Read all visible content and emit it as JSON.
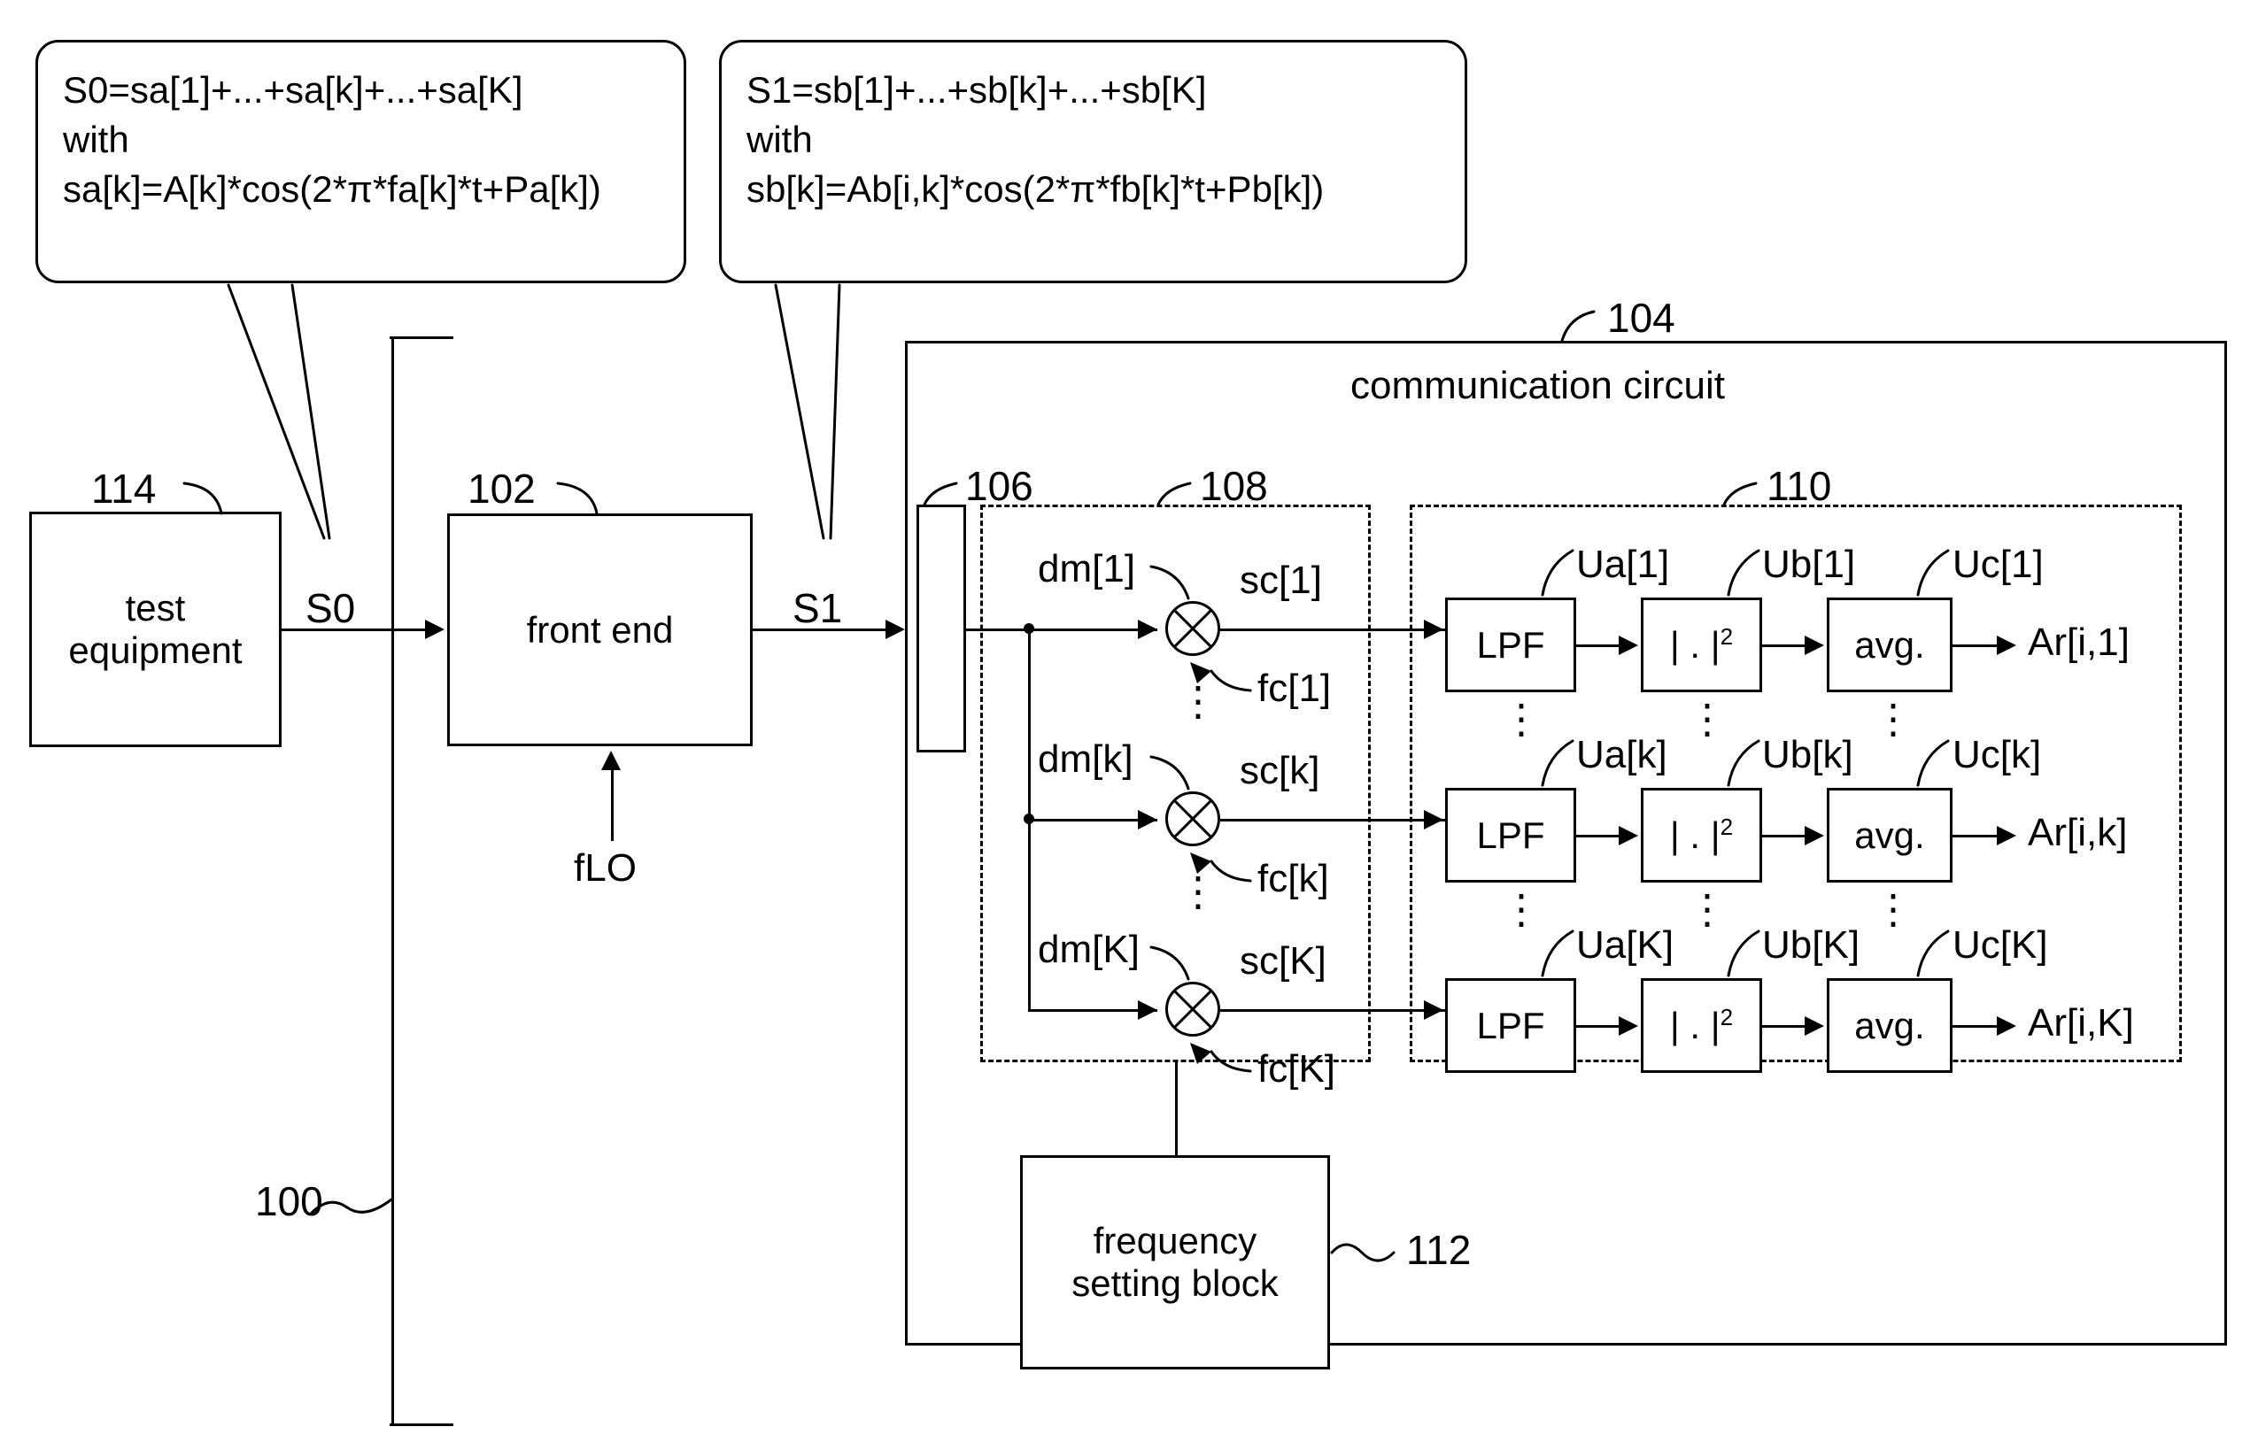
{
  "figure": {
    "system_ref": "100",
    "callouts": [
      {
        "id": "s0-callout",
        "line1": "S0=sa[1]+...+sa[k]+...+sa[K]",
        "line2": "with",
        "line3": "sa[k]=A[k]*cos(2*π*fa[k]*t+Pa[k])"
      },
      {
        "id": "s1-callout",
        "line1": "S1=sb[1]+...+sb[k]+...+sb[K]",
        "line2": "with",
        "line3": "sb[k]=Ab[i,k]*cos(2*π*fb[k]*t+Pb[k])"
      }
    ],
    "blocks": {
      "test_equipment": {
        "ref": "114",
        "line1": "test",
        "line2": "equipment"
      },
      "front_end": {
        "ref": "102",
        "label": "front end",
        "control_input": "fLO"
      },
      "communication_circuit": {
        "ref": "104",
        "label": "communication circuit"
      },
      "interface": {
        "ref": "106"
      },
      "mixer_group": {
        "ref": "108"
      },
      "detector_group": {
        "ref": "110"
      },
      "frequency_setting_block": {
        "ref": "112",
        "line1": "frequency",
        "line2": "setting block"
      }
    },
    "signals": {
      "s0": "S0",
      "s1": "S1"
    },
    "mixer_rows": [
      {
        "dm": "dm[1]",
        "sc": "sc[1]",
        "fc": "fc[1]"
      },
      {
        "dm": "dm[k]",
        "sc": "sc[k]",
        "fc": "fc[k]"
      },
      {
        "dm": "dm[K]",
        "sc": "sc[K]",
        "fc": "fc[K]"
      }
    ],
    "detector_rows": [
      {
        "ua": "Ua[1]",
        "ub": "Ub[1]",
        "uc": "Uc[1]",
        "out": "Ar[i,1]"
      },
      {
        "ua": "Ua[k]",
        "ub": "Ub[k]",
        "uc": "Uc[k]",
        "out": "Ar[i,k]"
      },
      {
        "ua": "Ua[K]",
        "ub": "Ub[K]",
        "uc": "Uc[K]",
        "out": "Ar[i,K]"
      }
    ],
    "stage_labels": {
      "lpf": "LPF",
      "magsq_base": "| . |",
      "magsq_exp": "2",
      "avg": "avg."
    },
    "ellipsis": "⋮",
    "colors": {
      "ink": "#000000",
      "paper": "#ffffff"
    }
  }
}
